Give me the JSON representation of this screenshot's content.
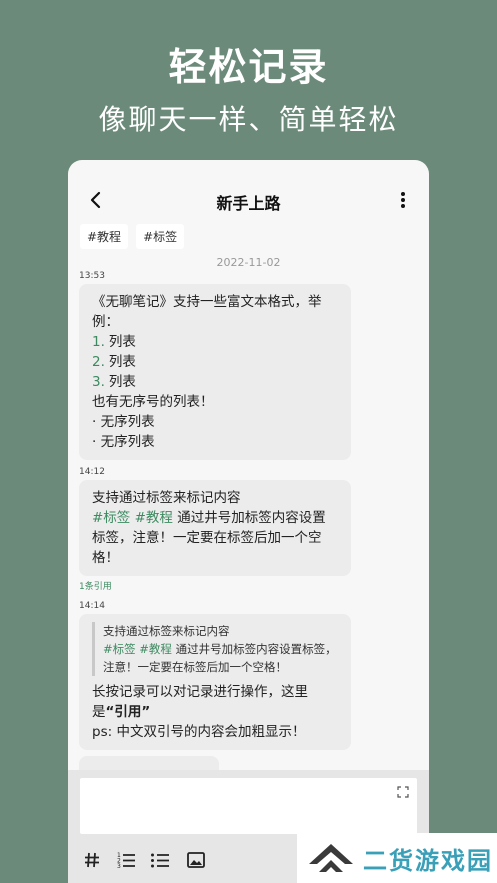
{
  "hero": {
    "title": "轻松记录",
    "subtitle": "像聊天一样、简单轻松"
  },
  "nav": {
    "title": "新手上路",
    "back_icon": "chevron-left-icon",
    "more_icon": "more-vertical-icon"
  },
  "tags": [
    "#教程",
    "#标签"
  ],
  "date": "2022-11-02",
  "messages": [
    {
      "time": "13:53",
      "intro": "《无聊笔记》支持一些富文本格式，举例：",
      "ordered": [
        {
          "num": "1.",
          "text": "列表"
        },
        {
          "num": "2.",
          "text": "列表"
        },
        {
          "num": "3.",
          "text": "列表"
        }
      ],
      "middle": "也有无序号的列表！",
      "unordered": [
        "·  无序列表",
        "·  无序列表"
      ]
    },
    {
      "time": "14:12",
      "line1": "支持通过标签来标记内容",
      "tag1": "#标签",
      "tag2": "#教程",
      "line2": " 通过井号加标签内容设置标签，注意！一定要在标签后加一个空格！",
      "ref_count": "1条引用"
    },
    {
      "time": "14:14",
      "quote_line1": "支持通过标签来标记内容",
      "quote_tag1": "#标签",
      "quote_tag2": "#教程",
      "quote_line2": " 通过井号加标签内容设置标签，注意！一定要在标签后加一个空格！",
      "body1": "长按记录可以对记录进行操作，这里是",
      "body_bold": "“引用”",
      "body2": "ps: 中文双引号的内容会加粗显示！"
    }
  ],
  "composer": {
    "expand_icon": "expand-icon",
    "tools": [
      "hash-icon",
      "ordered-list-icon",
      "unordered-list-icon",
      "image-icon"
    ]
  },
  "watermark": {
    "text": "二货游戏园"
  },
  "colors": {
    "background": "#6b8a7a",
    "accent": "#3d8a61",
    "bubble": "#ececec"
  }
}
